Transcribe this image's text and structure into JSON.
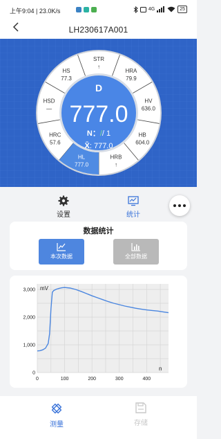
{
  "status_bar": {
    "time_speed": "上午9:04 | 23.0K/s",
    "network": "4G",
    "battery": "25"
  },
  "header": {
    "title": "LH230617A001"
  },
  "dial": {
    "center": {
      "letter": "D",
      "value": "777.0",
      "n_label": "N：",
      "n_slash": "/ 1",
      "mean": ": 777.0"
    },
    "segments": [
      {
        "name": "STR",
        "value": "↑"
      },
      {
        "name": "HRA",
        "value": "79.9"
      },
      {
        "name": "HV",
        "value": "636.0"
      },
      {
        "name": "HB",
        "value": "604.0"
      },
      {
        "name": "HRB",
        "value": "↑"
      },
      {
        "name": "HL",
        "value": "777.0"
      },
      {
        "name": "HRC",
        "value": "57.6"
      },
      {
        "name": "HSD",
        "value": "—"
      },
      {
        "name": "HS",
        "value": "77.3"
      }
    ]
  },
  "tabs": {
    "settings_label": "设置",
    "stats_label": "统计"
  },
  "stats": {
    "title": "数据统计",
    "current_label": "本次数据",
    "all_label": "全部数据"
  },
  "chart_data": {
    "type": "line",
    "ylabel": "mV",
    "xlabel": "n",
    "xlim": [
      0,
      480
    ],
    "ylim": [
      0,
      3200
    ],
    "x_ticks": [
      0,
      100,
      200,
      300,
      400
    ],
    "y_ticks": [
      0,
      1000,
      2000,
      3000
    ],
    "y_tick_labels": [
      "0",
      "1,000",
      "2,000",
      "3,000"
    ],
    "grid": true,
    "series": [
      {
        "color": "#4a86e0",
        "x": [
          0,
          10,
          20,
          30,
          40,
          45,
          50,
          55,
          60,
          70,
          80,
          90,
          100,
          120,
          140,
          160,
          180,
          200,
          220,
          240,
          260,
          280,
          300,
          320,
          340,
          360,
          380,
          400,
          420,
          440,
          460,
          480
        ],
        "y": [
          780,
          790,
          820,
          880,
          1050,
          1400,
          2300,
          2900,
          2960,
          3010,
          3040,
          3060,
          3070,
          3050,
          3000,
          2930,
          2850,
          2770,
          2700,
          2630,
          2560,
          2500,
          2450,
          2400,
          2360,
          2320,
          2290,
          2260,
          2240,
          2220,
          2190,
          2160
        ]
      }
    ]
  },
  "bottom_nav": {
    "measure_label": "测量",
    "save_label": "存储"
  }
}
